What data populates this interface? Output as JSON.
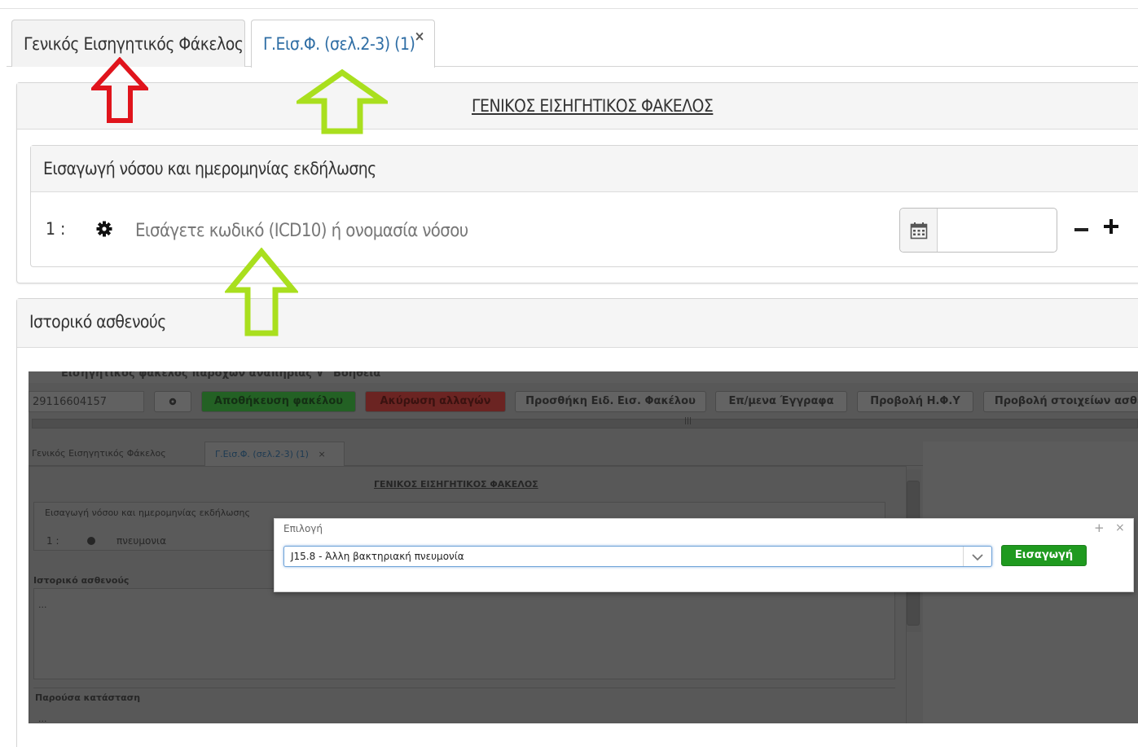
{
  "tabs": [
    {
      "label": "Γενικός Εισηγητικός Φάκελος",
      "close": ""
    },
    {
      "label": "Γ.Εισ.Φ. (σελ.2-3) (1)",
      "close": "×"
    }
  ],
  "main_panel": {
    "title": "ΓΕΝΙΚΟΣ ΕΙΣΗΓΗΤΙΚΟΣ ΦΑΚΕΛΟΣ",
    "section_title": "Εισαγωγή νόσου και ημερομηνίας εκδήλωσης",
    "row_number": "1 :",
    "disease_placeholder": "Εισάγετε κωδικό (ICD10) ή ονομασία νόσου",
    "date_value": ""
  },
  "history_panel": {
    "title": "Ιστορικό ασθενούς"
  },
  "screenshot": {
    "menu_left": "Εισηγητικός φάκελος παροχών αναπηρίας ∨",
    "menu_right": "Βοήθεια",
    "id_field": "29116604157",
    "buttons": {
      "save": "Αποθήκευση φακέλου",
      "cancel": "Ακύρωση αλλαγών",
      "add": "Προσθήκη Ειδ. Εισ. Φακέλου",
      "docs": "Επ/μενα Έγγραφα",
      "view_hfy": "Προβολή Η.Φ.Υ",
      "view_details": "Προβολή στοιχείων ασθε"
    },
    "scroll_grip": "|||",
    "tabs": [
      "Γενικός Εισηγητικός Φάκελος",
      "Γ.Εισ.Φ. (σελ.2-3) (1)",
      "×"
    ],
    "title": "ΓΕΝΙΚΟΣ ΕΙΣΗΓΗΤΙΚΟΣ ΦΑΚΕΛΟΣ",
    "section_title": "Εισαγωγή νόσου και ημερομηνίας εκδήλωσης",
    "row_number": "1 :",
    "row_value": "πνευμονια",
    "history_title": "Ιστορικό ασθενούς",
    "history_dots": "...",
    "current_title": "Παρούσα κατάσταση",
    "current_dots": "..."
  },
  "modal": {
    "title": "Επιλογή",
    "plus": "+",
    "close": "×",
    "selected": "J15.8 - Άλλη βακτηριακή πνευμονία",
    "insert_label": "Εισαγωγή"
  },
  "colors": {
    "red_arrow": "#e0141c",
    "green_arrow": "#a9df1e",
    "insert_button": "#1f9a1f",
    "active_tab_text": "#2f6ea5"
  }
}
